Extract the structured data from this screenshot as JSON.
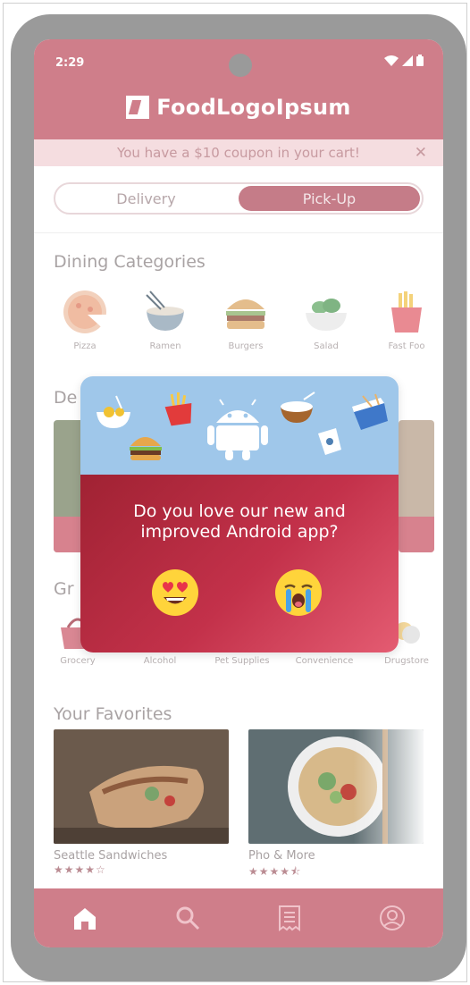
{
  "status_bar": {
    "time": "2:29",
    "icons": [
      "wifi-icon",
      "signal-icon",
      "battery-icon"
    ]
  },
  "brand": {
    "name": "FoodLogoIpsum",
    "logo_icon": "brand-logo-icon"
  },
  "coupon": {
    "text": "You have a $10 coupon in your cart!",
    "close": "✕"
  },
  "order_mode": {
    "options": [
      "Delivery",
      "Pick-Up"
    ],
    "selected": "Pick-Up"
  },
  "dining": {
    "title": "Dining Categories",
    "categories": [
      {
        "label": "Pizza",
        "icon": "pizza-icon"
      },
      {
        "label": "Ramen",
        "icon": "ramen-icon"
      },
      {
        "label": "Burgers",
        "icon": "burger-icon"
      },
      {
        "label": "Salad",
        "icon": "salad-icon"
      },
      {
        "label": "Fast Foo",
        "icon": "fries-icon"
      }
    ]
  },
  "deals": {
    "title": "De"
  },
  "groceries": {
    "title": "Gr",
    "items": [
      {
        "label": "Grocery",
        "icon": "basket-icon"
      },
      {
        "label": "Alcohol",
        "icon": "bottle-icon"
      },
      {
        "label": "Pet Supplies",
        "icon": "paw-icon"
      },
      {
        "label": "Convenience",
        "icon": "store-icon"
      },
      {
        "label": "Drugstore",
        "icon": "pill-icon"
      }
    ]
  },
  "favorites": {
    "title": "Your Favorites",
    "items": [
      {
        "name": "Seattle Sandwiches",
        "stars": "★★★★☆",
        "rating": 4
      },
      {
        "name": "Pho & More",
        "stars": "★★★★⯪",
        "rating": 4.5
      }
    ]
  },
  "bottom_nav": [
    {
      "name": "home",
      "icon": "home-icon",
      "active": true
    },
    {
      "name": "search",
      "icon": "search-icon",
      "active": false
    },
    {
      "name": "orders",
      "icon": "receipt-icon",
      "active": false
    },
    {
      "name": "account",
      "icon": "account-icon",
      "active": false
    }
  ],
  "feedback_modal": {
    "question_line1": "Do you love our new and",
    "question_line2": "improved Android app?",
    "options": [
      {
        "icon": "heart-eyes-emoji-icon",
        "meaning": "love"
      },
      {
        "icon": "crying-emoji-icon",
        "meaning": "dislike"
      }
    ]
  },
  "colors": {
    "primary": "#cf7e8a",
    "modal_gradient_start": "#a02233",
    "modal_gradient_end": "#e45c72",
    "modal_header": "#9fc7ea",
    "emoji_yellow": "#ffd43b"
  }
}
